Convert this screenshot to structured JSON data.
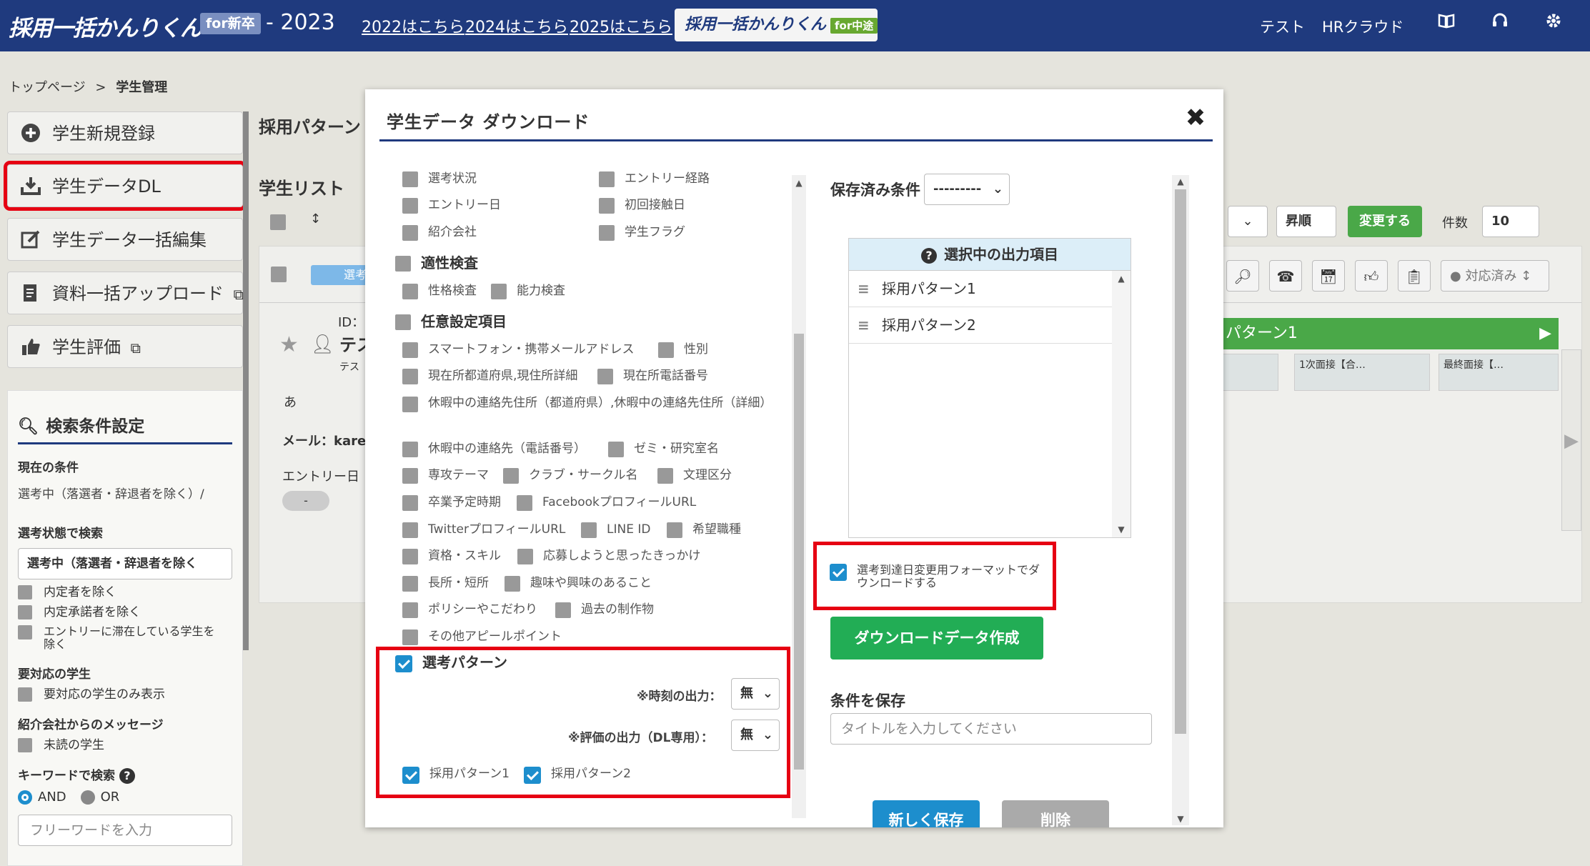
{
  "header": {
    "logo_text": "採用一括かんりくん",
    "logo_tag": "for新卒",
    "year": "- 2023",
    "links": [
      "2022はこちら",
      "2024はこちら",
      "2025はこちら"
    ],
    "mid_career_logo": "採用一括かんりくん",
    "mid_career_tag": "for中途",
    "user": "テスト",
    "service": "HRクラウド",
    "icons": [
      "book-icon",
      "headset-icon",
      "gear-icon"
    ]
  },
  "breadcrumb": {
    "home": "トップページ",
    "sep": ">",
    "current": "学生管理"
  },
  "sidebar": {
    "buttons": [
      {
        "label": "学生新規登録",
        "icon": "plus-circle-icon"
      },
      {
        "label": "学生データDL",
        "icon": "download-icon"
      },
      {
        "label": "学生データ一括編集",
        "icon": "edit-icon"
      },
      {
        "label": "資料一括アップロード",
        "icon": "document-upload-icon"
      },
      {
        "label": "学生評価",
        "icon": "thumbs-up-icon"
      }
    ],
    "filter": {
      "title": "検索条件設定",
      "current_label": "現在の条件",
      "current_value": "選考中（落選者・辞退者を除く）/",
      "status_label": "選考状態で検索",
      "status_value": "選考中（落選者・辞退者を除く",
      "status_checks": [
        "内定者を除く",
        "内定承諾者を除く",
        "エントリーに滞在している学生を除く"
      ],
      "needs_label": "要対応の学生",
      "needs_check": "要対応の学生のみ表示",
      "agency_label": "紹介会社からのメッセージ",
      "agency_check": "未読の学生",
      "keyword_label": "キーワードで検索",
      "and_label": "AND",
      "or_label": "OR",
      "keyword_placeholder": "フリーワードを入力"
    }
  },
  "background": {
    "pattern_title": "採用パターン",
    "list_title": "学生リスト",
    "sort_order": "昇順",
    "change_btn": "変更する",
    "count_label": "件数",
    "count_value": "10",
    "status_select": "対応済み",
    "pattern_bar": "パターン1",
    "stage1": "1次面接【合…",
    "stage2": "最終面接【…",
    "id_label": "ID：",
    "name_short": "テス",
    "name_kana": "テス",
    "note": "あ",
    "mail_label": "メール：karen",
    "entry_label": "エントリー日",
    "dash": "-",
    "filter_tag": "選考"
  },
  "modal": {
    "title": "学生データ ダウンロード",
    "left": {
      "row1": [
        "選考状況",
        "エントリー経路"
      ],
      "row2": [
        "エントリー日",
        "初回接触日"
      ],
      "row3": [
        "紹介会社",
        "学生フラグ"
      ],
      "section_aptitude": "適性検査",
      "aptitude_items": [
        "性格検査",
        "能力検査"
      ],
      "section_custom": "任意設定項目",
      "custom_items": [
        [
          "スマートフォン・携帯メールアドレス",
          "性別"
        ],
        [
          "現在所都道府県,現住所詳細",
          "現在所電話番号"
        ],
        [
          "休暇中の連絡先住所（都道府県）,休暇中の連絡先住所（詳細）"
        ],
        [
          "休暇中の連絡先（電話番号）",
          "ゼミ・研究室名"
        ],
        [
          "専攻テーマ",
          "クラブ・サークル名",
          "文理区分"
        ],
        [
          "卒業予定時期",
          "FacebookプロフィールURL"
        ],
        [
          "TwitterプロフィールURL",
          "LINE ID",
          "希望職種"
        ],
        [
          "資格・スキル",
          "応募しようと思ったきっかけ"
        ],
        [
          "長所・短所",
          "趣味や興味のあること"
        ],
        [
          "ポリシーやこだわり",
          "過去の制作物"
        ],
        [
          "その他アピールポイント"
        ]
      ],
      "section_pattern": "選考パターン",
      "time_output_label": "※時刻の出力：",
      "time_output_value": "無",
      "eval_output_label": "※評価の出力（DL専用）：",
      "eval_output_value": "無",
      "patterns": [
        "採用パターン1",
        "採用パターン2"
      ]
    },
    "right": {
      "saved_label": "保存済み条件",
      "saved_value": "---------",
      "selected_header": "選択中の出力項目",
      "selected_items": [
        "採用パターン1",
        "採用パターン2"
      ],
      "format_check": "選考到達日変更用フォーマットでダウンロードする",
      "create_btn": "ダウンロードデータ作成",
      "save_label": "条件を保存",
      "title_placeholder": "タイトルを入力してください",
      "new_save_btn": "新しく保存",
      "delete_btn": "削除"
    }
  },
  "colors": {
    "header": "#1f3a7e",
    "accent_blue": "#1d8ecd",
    "green": "#22ad55",
    "highlight": "#e60012"
  }
}
